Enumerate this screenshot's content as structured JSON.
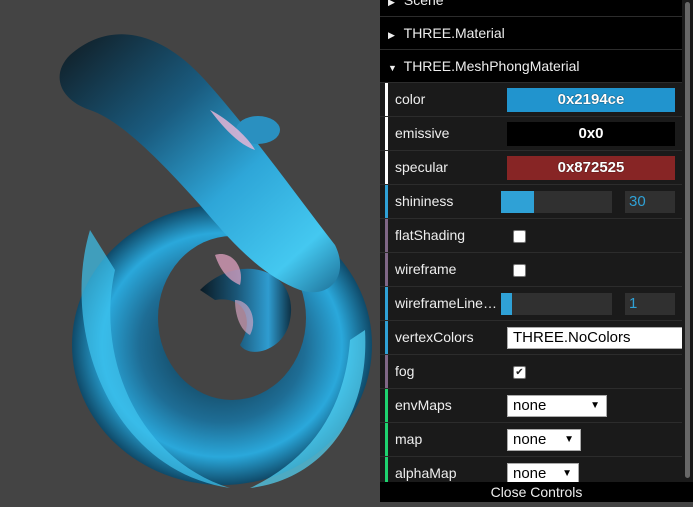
{
  "gui": {
    "folders": [
      {
        "label": "Scene"
      },
      {
        "label": "THREE.Material",
        "open": false
      },
      {
        "label": "THREE.MeshPhongMaterial",
        "open": true
      }
    ],
    "rows": {
      "color": {
        "label": "color",
        "value": "0x2194ce",
        "swatch": "#2194ce"
      },
      "emissive": {
        "label": "emissive",
        "value": "0x0",
        "swatch": "#000000"
      },
      "specular": {
        "label": "specular",
        "value": "0x872525",
        "swatch": "#872525"
      },
      "shininess": {
        "label": "shininess",
        "value": "30",
        "fraction": 0.3
      },
      "flatShading": {
        "label": "flatShading",
        "checked": false
      },
      "wireframe": {
        "label": "wireframe",
        "checked": false
      },
      "wireframeLinewidth": {
        "label": "wireframeLinewidth",
        "value": "1",
        "fraction": 0.1
      },
      "vertexColors": {
        "label": "vertexColors",
        "value": "THREE.NoColors"
      },
      "fog": {
        "label": "fog",
        "checked": true
      },
      "envMaps": {
        "label": "envMaps",
        "value": "none"
      },
      "map": {
        "label": "map",
        "value": "none"
      },
      "alphaMap": {
        "label": "alphaMap",
        "value": "none"
      }
    },
    "close_label": "Close Controls"
  },
  "icons": {
    "folder_closed": "triangle-right-icon",
    "folder_open": "triangle-down-icon",
    "select_chevron": "chevron-down-icon",
    "checkmark": "check-icon"
  },
  "colors": {
    "number_accent": "#2fa1d6",
    "boolean_bar": "#806787",
    "option_bar": "#1ed36f",
    "page_bg": "#444444"
  }
}
